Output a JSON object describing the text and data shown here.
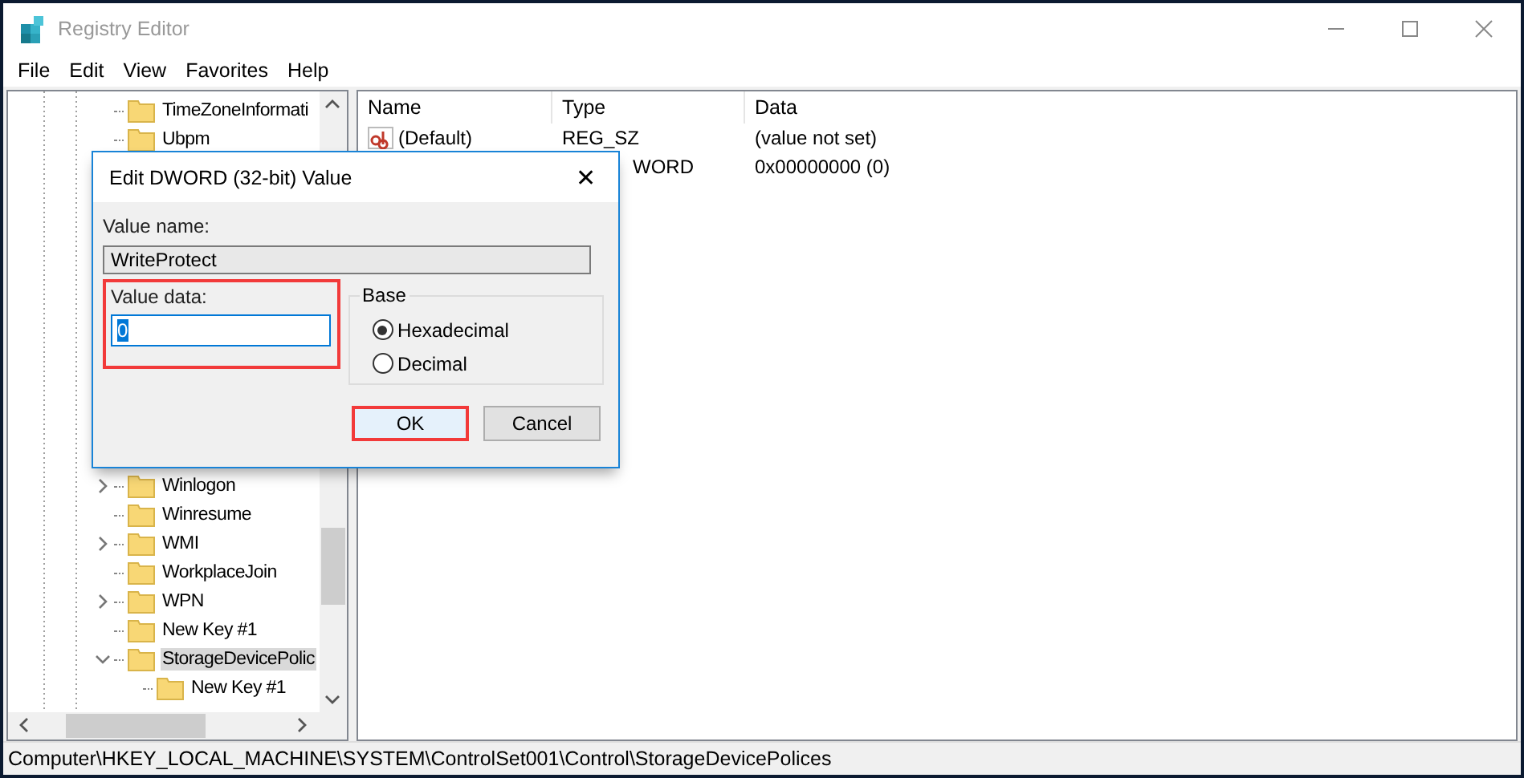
{
  "window": {
    "title": "Registry Editor"
  },
  "menu": [
    "File",
    "Edit",
    "View",
    "Favorites",
    "Help"
  ],
  "tree": {
    "items": [
      {
        "label": "TimeZoneInformati"
      },
      {
        "label": "Ubpm"
      },
      {
        "label": "Winlogon",
        "expanded": false
      },
      {
        "label": "Winresume"
      },
      {
        "label": "WMI",
        "expanded": false
      },
      {
        "label": "WorkplaceJoin"
      },
      {
        "label": "WPN",
        "expanded": false
      },
      {
        "label": "New Key #1"
      },
      {
        "label": "StorageDevicePolic",
        "expanded": true,
        "selected": true,
        "children": [
          {
            "label": "New Key #1",
            "selected": false
          }
        ]
      }
    ]
  },
  "values": {
    "columns": [
      "Name",
      "Type",
      "Data"
    ],
    "rows": [
      {
        "kind": "string",
        "name": "(Default)",
        "type": "REG_SZ",
        "data": "(value not set)"
      },
      {
        "kind": "covered",
        "type": "WORD",
        "data": "0x00000000 (0)"
      }
    ]
  },
  "dialog": {
    "title": "Edit DWORD (32-bit) Value",
    "close": "✕",
    "value_name": {
      "label": "Value name:",
      "value": "WriteProtect"
    },
    "value_data": {
      "label": "Value data:",
      "value": "0",
      "highlighted": true
    },
    "base": {
      "label": "Base",
      "options": [
        {
          "label": "Hexadecimal",
          "selected": true
        },
        {
          "label": "Decimal",
          "selected": false
        }
      ]
    },
    "buttons": [
      {
        "label": "OK",
        "highlighted": true
      },
      {
        "label": "Cancel",
        "highlighted": false
      }
    ]
  },
  "status_bar": "Computer\\HKEY_LOCAL_MACHINE\\SYSTEM\\ControlSet001\\Control\\StorageDevicePolices"
}
